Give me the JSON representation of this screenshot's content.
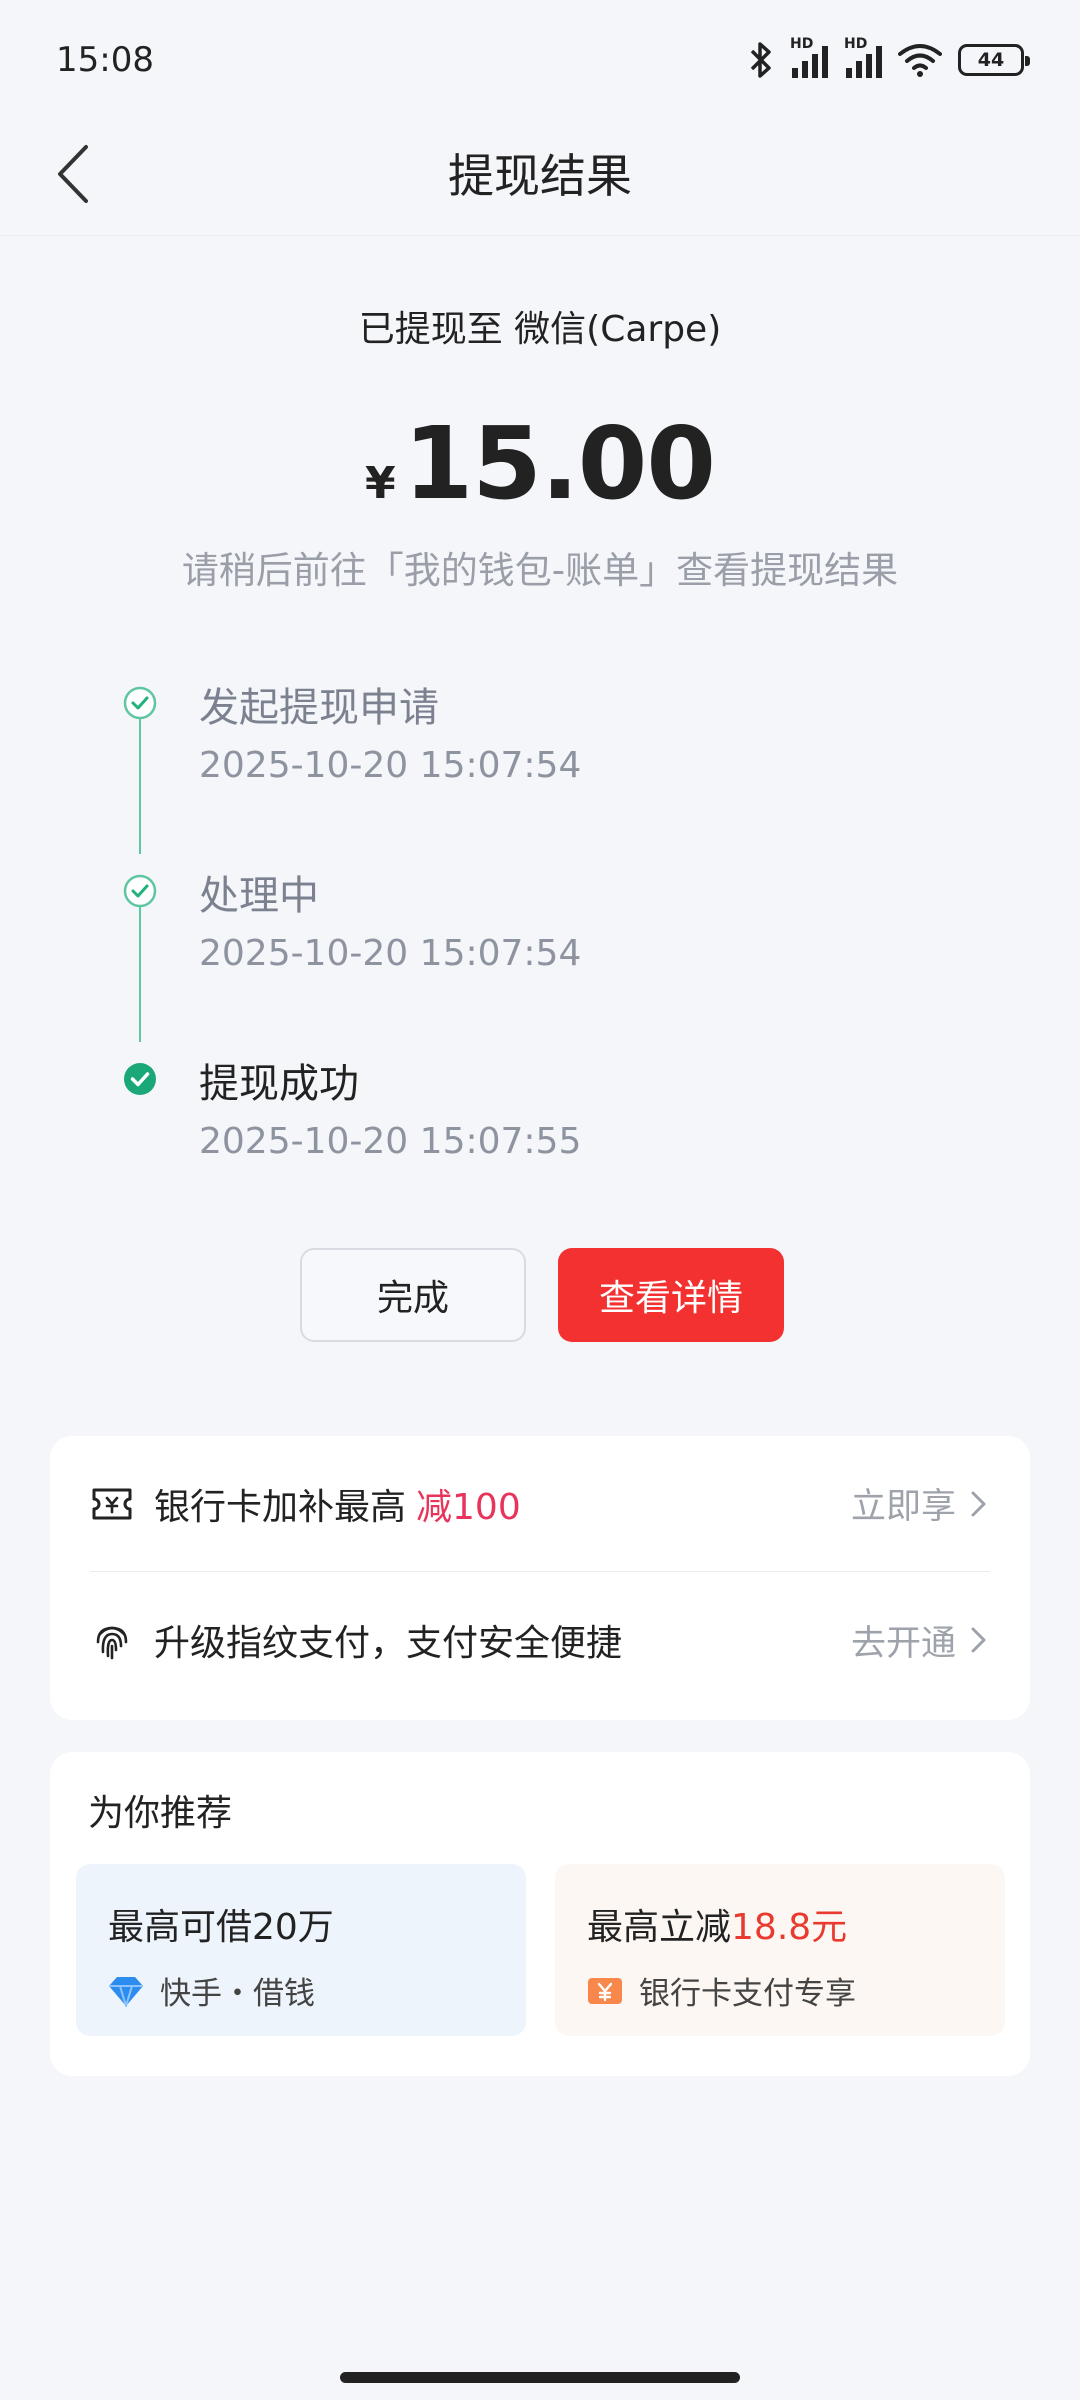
{
  "status_bar": {
    "time": "15:08",
    "hd1": "HD",
    "hd2": "HD",
    "battery": "44"
  },
  "header": {
    "title": "提现结果"
  },
  "result": {
    "destination": "已提现至 微信(Carpe)",
    "currency": "¥",
    "amount": "15.00",
    "hint": "请稍后前往「我的钱包-账单」查看提现结果"
  },
  "timeline": [
    {
      "title": "发起提现申请",
      "time": "2025-10-20 15:07:54"
    },
    {
      "title": "处理中",
      "time": "2025-10-20 15:07:54"
    },
    {
      "title": "提现成功",
      "time": "2025-10-20 15:07:55"
    }
  ],
  "buttons": {
    "done": "完成",
    "details": "查看详情"
  },
  "promo": [
    {
      "text": "银行卡加补最高",
      "highlight": "减100",
      "action": "立即享",
      "icon": "ticket-icon"
    },
    {
      "text": "升级指纹支付，支付安全便捷",
      "action": "去开通",
      "icon": "fingerprint-icon"
    }
  ],
  "recommend": {
    "title": "为你推荐",
    "tiles": [
      {
        "headline": "最高可借20万",
        "sub": "快手・借钱",
        "icon": "diamond-icon"
      },
      {
        "headline_prefix": "最高立减",
        "headline_highlight": "18.8元",
        "sub": "银行卡支付专享",
        "icon": "yuan-coupon-icon"
      }
    ]
  },
  "colors": {
    "accent_green": "#20b27a",
    "primary_red": "#f33131",
    "promo_pink": "#e8345a",
    "tile_blue": "#edf4fc",
    "tile_peach": "#fdf7f3"
  }
}
